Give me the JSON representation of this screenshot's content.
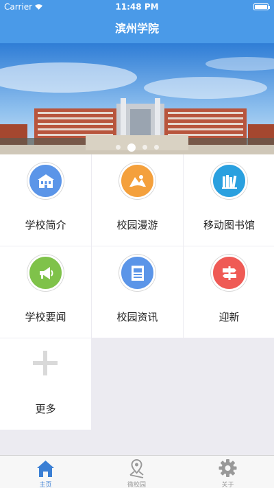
{
  "status_bar": {
    "carrier": "Carrier",
    "time": "11:48 PM"
  },
  "nav": {
    "title": "滨州学院"
  },
  "grid": [
    {
      "label": "学校简介",
      "icon": "school-building-icon",
      "color": "#5b95e8"
    },
    {
      "label": "校园漫游",
      "icon": "map-route-icon",
      "color": "#f4a03c"
    },
    {
      "label": "移动图书馆",
      "icon": "bookshelf-icon",
      "color": "#2aa0df"
    },
    {
      "label": "学校要闻",
      "icon": "megaphone-icon",
      "color": "#7fc24a"
    },
    {
      "label": "校园资讯",
      "icon": "newspaper-icon",
      "color": "#5b95e8"
    },
    {
      "label": "迎新",
      "icon": "signpost-icon",
      "color": "#ef5a55"
    },
    {
      "label": "更多",
      "icon": "plus-icon"
    }
  ],
  "tabs": [
    {
      "label": "主页",
      "icon": "home-icon",
      "active": true
    },
    {
      "label": "微校园",
      "icon": "location-pin-icon",
      "active": false
    },
    {
      "label": "关于",
      "icon": "gear-icon",
      "active": false
    }
  ],
  "colors": {
    "primary": "#4a9ae8",
    "active_tab": "#3b7fd4",
    "inactive_tab": "#999999"
  }
}
